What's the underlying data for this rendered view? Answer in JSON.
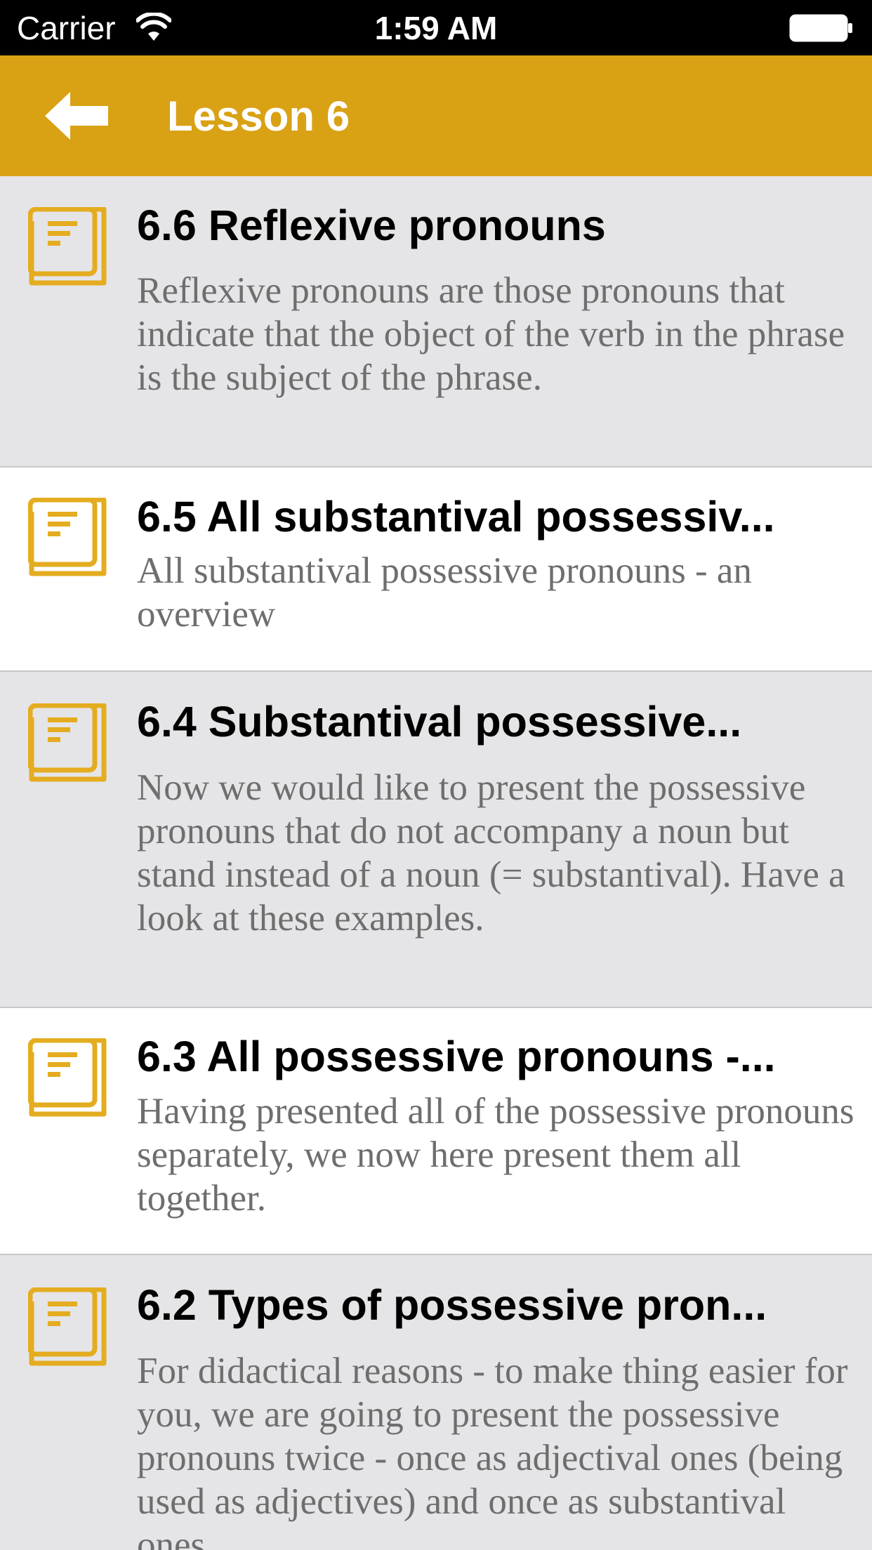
{
  "status_bar": {
    "carrier": "Carrier",
    "time": "1:59 AM",
    "wifi_icon": "wifi-icon",
    "battery_icon": "battery-icon"
  },
  "nav": {
    "back_icon": "arrow-left-icon",
    "title": "Lesson 6",
    "color": "#d9a114"
  },
  "lessons": [
    {
      "title": "6.6 Reflexive pronouns",
      "description": "Reflexive pronouns are those pronouns that indicate that the object of the verb in the phrase is the subject of the phrase.",
      "icon": "book-icon"
    },
    {
      "title": "6.5 All substantival possessiv...",
      "description": "All substantival possessive pronouns - an overview",
      "icon": "book-icon"
    },
    {
      "title": "6.4 Substantival possessive...",
      "description": "Now we would like to present the possessive pronouns that do not accompany a noun but stand instead of a noun (= substantival). Have a look at these examples.",
      "icon": "book-icon"
    },
    {
      "title": "6.3 All possessive pronouns -...",
      "description": "Having presented all of the possessive pronouns separately, we now here present them all together.",
      "icon": "book-icon"
    },
    {
      "title": "6.2 Types of possessive pron...",
      "description": "For didactical reasons - to make thing easier for you, we are going to present the possessive pronouns twice - once as adjectival ones (being used as adjectives) and once as substantival ones",
      "icon": "book-icon"
    }
  ]
}
